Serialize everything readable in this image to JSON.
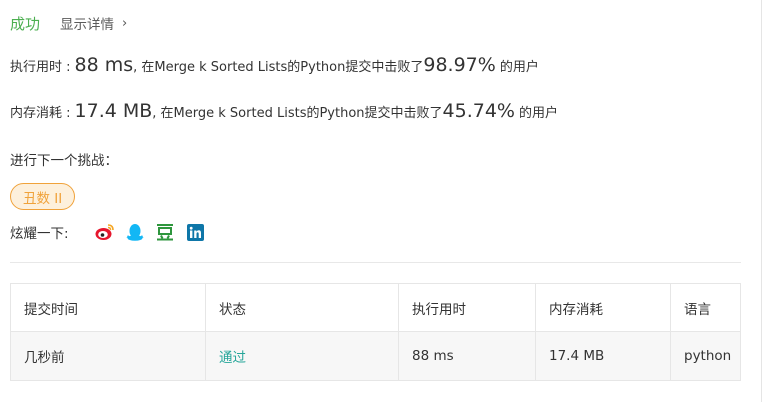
{
  "result": {
    "status": "成功",
    "details_link": "显示详情",
    "chevron": "›"
  },
  "runtime": {
    "label": "执行用时 :",
    "value": "88 ms",
    "middle": ", 在Merge k Sorted Lists的Python提交中击败了",
    "percent": "98.97%",
    "suffix": "的用户"
  },
  "memory": {
    "label": "内存消耗 :",
    "value": "17.4 MB",
    "middle": ", 在Merge k Sorted Lists的Python提交中击败了",
    "percent": "45.74%",
    "suffix": "的用户"
  },
  "next_challenge": {
    "label": "进行下一个挑战：",
    "tag": "丑数 II"
  },
  "share": {
    "label": "炫耀一下:",
    "icons": [
      "weibo-icon",
      "qq-icon",
      "douban-icon",
      "linkedin-icon"
    ]
  },
  "table": {
    "headers": [
      "提交时间",
      "状态",
      "执行用时",
      "内存消耗",
      "语言"
    ],
    "rows": [
      [
        "几秒前",
        "通过",
        "88 ms",
        "17.4 MB",
        "python"
      ]
    ]
  },
  "colors": {
    "success": "#4caf50",
    "accepted": "#26a69a",
    "tag_text": "#f0a23a",
    "tag_bg": "#fdf0dc",
    "weibo": "#e6162d",
    "qq": "#12b7f5",
    "douban": "#2e963d",
    "linkedin": "#0e76a8"
  }
}
